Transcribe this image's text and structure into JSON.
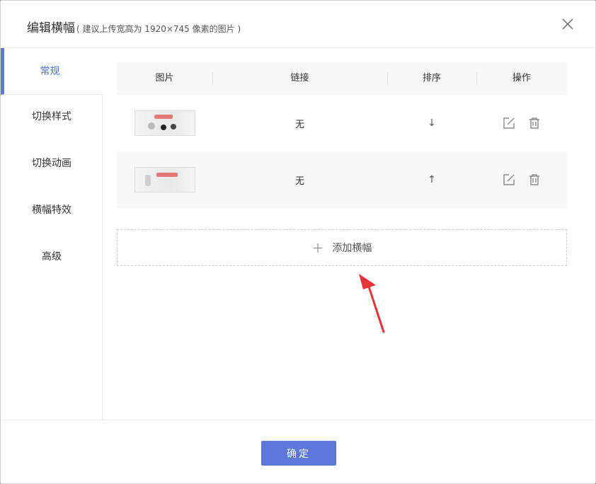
{
  "dialog": {
    "title": "编辑横幅",
    "subtitle": "( 建议上传宽高为 1920×745 像素的图片 )"
  },
  "sidebar": {
    "items": [
      {
        "label": "常规",
        "active": true
      },
      {
        "label": "切换样式",
        "active": false
      },
      {
        "label": "切换动画",
        "active": false
      },
      {
        "label": "横幅特效",
        "active": false
      },
      {
        "label": "高级",
        "active": false
      }
    ]
  },
  "table": {
    "headers": [
      "图片",
      "链接",
      "排序",
      "操作"
    ],
    "rows": [
      {
        "link": "无",
        "sort_icon": "↓"
      },
      {
        "link": "无",
        "sort_icon": "↑"
      }
    ]
  },
  "add_banner": {
    "label": "添加横幅"
  },
  "footer": {
    "ok_label": "确定"
  },
  "colors": {
    "accent": "#5b78d8",
    "active_text": "#4a70d4",
    "annotation": "#e8333a"
  },
  "icons": [
    "close-icon",
    "edit-icon",
    "trash-icon",
    "plus-icon",
    "arrow-down-icon",
    "arrow-up-icon"
  ]
}
